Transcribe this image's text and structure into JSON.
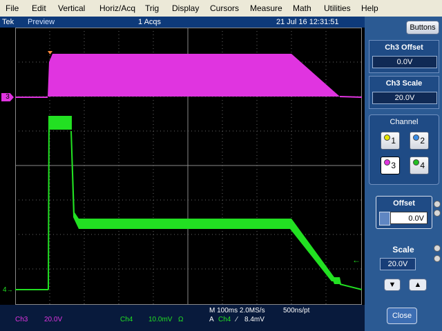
{
  "menu": [
    "File",
    "Edit",
    "Vertical",
    "Horiz/Acq",
    "Trig",
    "Display",
    "Cursors",
    "Measure",
    "Math",
    "Utilities",
    "Help"
  ],
  "status": {
    "brand": "Tek",
    "mode": "Preview",
    "acqs": "1 Acqs",
    "datetime": "21 Jul 16 12:31:51"
  },
  "channels": {
    "ch3": {
      "marker": "3",
      "name": "Ch3",
      "scale": "20.0V",
      "color": "#e034e0"
    },
    "ch4": {
      "marker": "4",
      "name": "Ch4",
      "scale": "10.0mV",
      "coupling": "Ω",
      "color": "#22e022"
    }
  },
  "timebase": {
    "horizontal": "M 100ms 2.0MS/s",
    "resolution": "500ns/pt",
    "trigger_prefix": "A",
    "trigger_source": "Ch4",
    "trigger_slope": "⁄",
    "trigger_level": "8.4mV"
  },
  "panel": {
    "buttons_label": "Buttons",
    "offset_title": "Ch3 Offset",
    "offset_value": "0.0V",
    "scale_title": "Ch3 Scale",
    "scale_value": "20.0V",
    "channel_title": "Channel",
    "channel_buttons": [
      "1",
      "2",
      "3",
      "4"
    ],
    "channel_colors": [
      "#e6e600",
      "#3a8de6",
      "#e034e0",
      "#22c022"
    ],
    "offset_label": "Offset",
    "offset_field": "0.0V",
    "scale_label": "Scale",
    "scale_field": "20.0V",
    "close_label": "Close",
    "down_glyph": "▼",
    "up_glyph": "▲"
  }
}
